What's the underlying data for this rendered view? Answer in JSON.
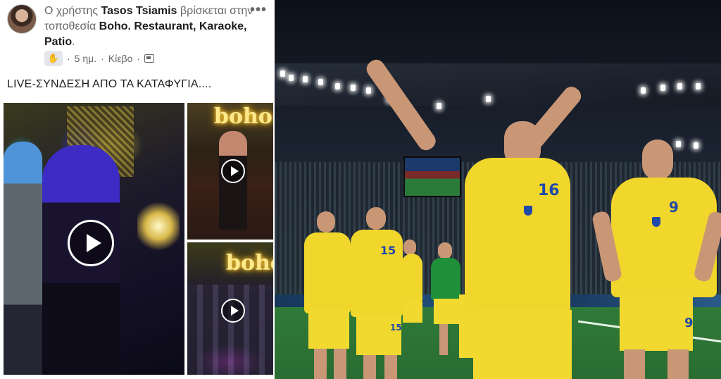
{
  "post": {
    "prefix": "Ο χρήστης",
    "user": "Tasos Tsiamis",
    "middle": "βρίσκεται στην τοποθεσία",
    "location": "Boho. Restaurant, Karaoke, Patio",
    "end": ".",
    "more_label": "•••",
    "time": "5 ημ.",
    "sep": "·",
    "city": "Κίεβο",
    "sep2": "·",
    "text": "LIVE-ΣΥΝΔΕΣΗ ΑΠΟ ΤΑ ΚΑΤΑΦΥΓΙΑ....",
    "media": {
      "neon_sign_1": "boho",
      "neon_sign_2": "boho"
    }
  },
  "photo": {
    "players": {
      "main_number": "16",
      "right_number": "9",
      "left_number": "15",
      "right_shorts_number": "9",
      "left_shorts_number": "15"
    }
  },
  "icons": {
    "wave": "waving-hand-icon",
    "calendar": "calendar-icon",
    "play": "play-icon",
    "more": "more-options-icon"
  },
  "colors": {
    "fb_gray": "#65676b",
    "fb_text": "#1c1e21",
    "kit_yellow": "#f1d62c",
    "kit_blue": "#1f4aa8"
  }
}
